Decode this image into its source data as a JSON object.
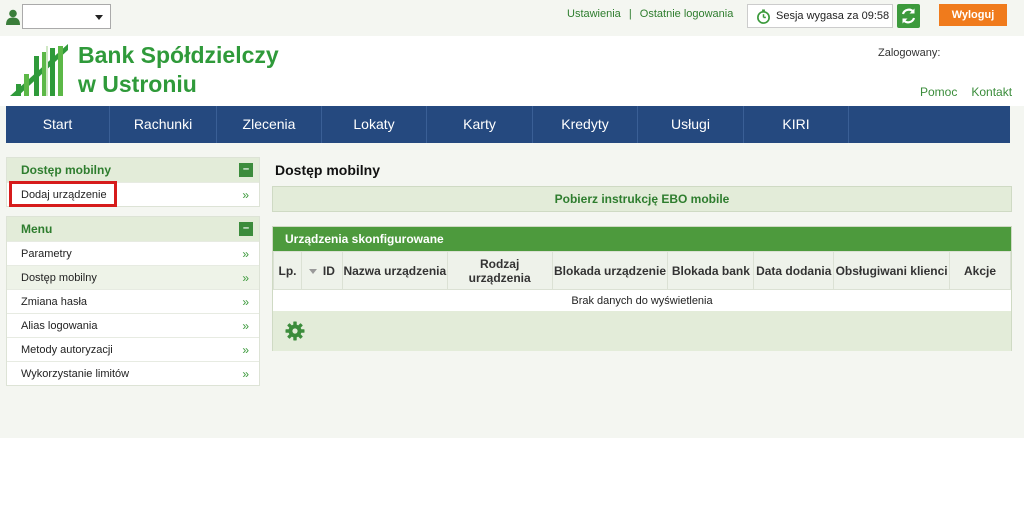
{
  "topbar": {
    "links": [
      "Ustawienia",
      "Ostatnie logowania"
    ],
    "separator": "|",
    "session_text": "Sesja wygasa za 09:58",
    "logout_label": "Wyloguj",
    "user_select_value": ""
  },
  "header": {
    "bank_name_line1": "Bank Spółdzielczy",
    "bank_name_line2": "w Ustroniu",
    "logged_label": "Zalogowany:",
    "help_links": [
      "Pomoc",
      "Kontakt"
    ]
  },
  "nav": {
    "items": [
      "Start",
      "Rachunki",
      "Zlecenia",
      "Lokaty",
      "Karty",
      "Kredyty",
      "Usługi",
      "KIRI"
    ]
  },
  "sidebar": {
    "mobile_panel": {
      "title": "Dostęp mobilny",
      "items": [
        "Dodaj urządzenie"
      ]
    },
    "menu_panel": {
      "title": "Menu",
      "items": [
        "Parametry",
        "Dostęp mobilny",
        "Zmiana hasła",
        "Alias logowania",
        "Metody autoryzacji",
        "Wykorzystanie limitów"
      ],
      "active_index": 1
    },
    "collapse_glyph": "–",
    "arrow_glyph": "»"
  },
  "main": {
    "title": "Dostęp mobilny",
    "download_label": "Pobierz instrukcję EBO mobile",
    "devices": {
      "title": "Urządzenia skonfigurowane",
      "columns": [
        "Lp.",
        "ID",
        "Nazwa urządzenia",
        "Rodzaj urządzenia",
        "Blokada urządzenie",
        "Blokada bank",
        "Data dodania",
        "Obsługiwani klienci",
        "Akcje"
      ],
      "empty_text": "Brak danych do wyświetlenia"
    }
  },
  "colors": {
    "brand_green": "#2f9a3a",
    "nav_blue": "#25497f",
    "logout_orange": "#f07b1c",
    "highlight_red": "#d61b1b"
  },
  "icons": [
    "user-icon",
    "dropdown-caret-icon",
    "clock-icon",
    "refresh-icon",
    "bank-logo",
    "collapse-icon",
    "chevron-double-right-icon",
    "sort-icon",
    "gear-icon"
  ]
}
